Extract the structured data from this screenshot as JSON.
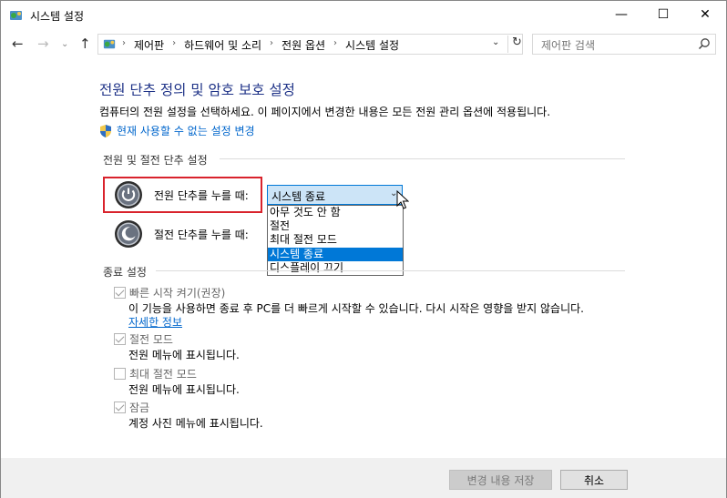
{
  "window": {
    "title": "시스템 설정",
    "controls": {
      "minimize": "—",
      "maximize": "☐",
      "close": "✕"
    }
  },
  "nav": {
    "back": "←",
    "forward": "→",
    "recent": "⌄",
    "up": "↑"
  },
  "address": {
    "crumbs": [
      "제어판",
      "하드웨어 및 소리",
      "전원 옵션",
      "시스템 설정"
    ],
    "separator": "›",
    "dropdown": "⌄",
    "refresh": "↻"
  },
  "search": {
    "placeholder": "제어판 검색"
  },
  "content": {
    "title": "전원 단추 정의 및 암호 보호 설정",
    "description": "컴퓨터의 전원 설정을 선택하세요. 이 페이지에서 변경한 내용은 모든 전원 관리 옵션에 적용됩니다.",
    "admin_link": "현재 사용할 수 없는 설정 변경",
    "power_section": "전원 및 절전 단추 설정",
    "power_button_label": "전원 단추를 누를 때:",
    "sleep_button_label": "절전 단추를 누를 때:",
    "power_button_value": "시스템 종료",
    "power_button_options": [
      "아무 것도 안 함",
      "절전",
      "최대 절전 모드",
      "시스템 종료",
      "디스플레이 끄기"
    ],
    "selected_option_index": 3,
    "shutdown_section": "종료 설정",
    "fast_startup_label": "빠른 시작 켜기(권장)",
    "fast_startup_desc": "이 기능을 사용하면 종료 후 PC를 더 빠르게 시작할 수 있습니다. 다시 시작은 영향을 받지 않습니다.",
    "more_info": "자세한 정보",
    "sleep_label": "절전 모드",
    "sleep_desc": "전원 메뉴에 표시됩니다.",
    "hibernate_label": "최대 절전 모드",
    "hibernate_desc": "전원 메뉴에 표시됩니다.",
    "lock_label": "잠금",
    "lock_desc": "계정 사진 메뉴에 표시됩니다.",
    "fast_startup_checked": true,
    "sleep_checked": true,
    "hibernate_checked": false,
    "lock_checked": true
  },
  "footer": {
    "save": "변경 내용 저장",
    "cancel": "취소"
  },
  "colors": {
    "title_blue": "#1e3287",
    "link_blue": "#0066cc",
    "selection": "#0078d7",
    "highlight_border": "#d9232c"
  }
}
